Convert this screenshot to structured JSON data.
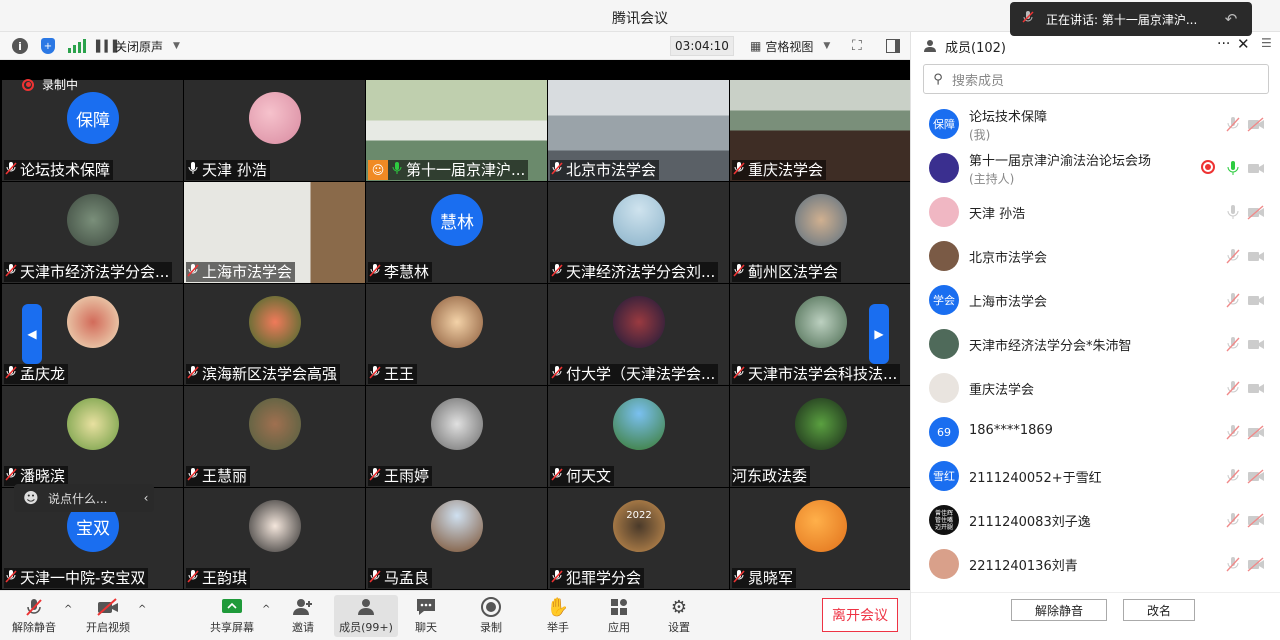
{
  "window": {
    "title": "腾讯会议"
  },
  "speaking_banner": {
    "label": "正在讲话: 第十一届京津沪..."
  },
  "toolbar": {
    "info_icon": "info-icon",
    "security_icon": "shield-icon",
    "signal_icon": "signal-bars-icon",
    "original_sound_label": "关闭原声",
    "timer": "03:04:10",
    "layout_label": "宫格视图"
  },
  "recording": {
    "label": "录制中"
  },
  "tiles": [
    {
      "name": "论坛技术保障",
      "avatar_text": "保障",
      "mic": "off"
    },
    {
      "name": "天津 孙浩",
      "mic": "on"
    },
    {
      "name": "第十一届京津沪...",
      "mic": "on",
      "host": true
    },
    {
      "name": "北京市法学会",
      "mic": "off"
    },
    {
      "name": "重庆法学会",
      "mic": "off"
    },
    {
      "name": "天津市经济法学分会...",
      "mic": "off"
    },
    {
      "name": "上海市法学会",
      "mic": "off"
    },
    {
      "name": "李慧林",
      "avatar_text": "慧林",
      "mic": "off"
    },
    {
      "name": "天津经济法学分会刘...",
      "mic": "off"
    },
    {
      "name": "蓟州区法学会",
      "mic": "off"
    },
    {
      "name": "孟庆龙",
      "mic": "off"
    },
    {
      "name": "滨海新区法学会高强",
      "mic": "off"
    },
    {
      "name": "王王",
      "mic": "off"
    },
    {
      "name": "付大学（天津法学会...",
      "mic": "off"
    },
    {
      "name": "天津市法学会科技法...",
      "mic": "off"
    },
    {
      "name": "潘晓滨",
      "mic": "off"
    },
    {
      "name": "王慧丽",
      "mic": "off"
    },
    {
      "name": "王雨婷",
      "mic": "off"
    },
    {
      "name": "何天文",
      "mic": "off"
    },
    {
      "name": "河东政法委",
      "mic": "none"
    },
    {
      "name": "天津一中院-安宝双",
      "avatar_text": "宝双",
      "mic": "off"
    },
    {
      "name": "王韵琪",
      "mic": "off"
    },
    {
      "name": "马孟良",
      "mic": "off"
    },
    {
      "name": "犯罪学分会",
      "mic": "off",
      "avatar_text": "2022"
    },
    {
      "name": "晁晓军",
      "mic": "off"
    }
  ],
  "chat_input": {
    "placeholder": "说点什么..."
  },
  "bottom_bar": {
    "unmute": "解除静音",
    "start_video": "开启视频",
    "share_screen": "共享屏幕",
    "invite": "邀请",
    "members": "成员(99+)",
    "chat": "聊天",
    "record": "录制",
    "raise_hand": "举手",
    "apps": "应用",
    "settings": "设置",
    "leave": "离开会议"
  },
  "panel": {
    "title": "成员(102)",
    "search_placeholder": "搜索成员",
    "members": [
      {
        "name": "论坛技术保障",
        "sub": "(我)",
        "avatar_text": "保障",
        "avatar_color": "#1a6ef0",
        "mic": "off",
        "cam": "off"
      },
      {
        "name": "第十一届京津沪渝法治论坛会场",
        "sub": "(主持人)",
        "avatar_color": "#3a2f8f",
        "mic": "on",
        "cam": "on",
        "recording": true
      },
      {
        "name": "天津 孙浩",
        "avatar_color": "#f0b7c3",
        "mic": "idle",
        "cam": "off"
      },
      {
        "name": "北京市法学会",
        "avatar_color": "#7a5a45",
        "mic": "off",
        "cam": "on"
      },
      {
        "name": "上海市法学会",
        "avatar_text": "学会",
        "avatar_color": "#1a6ef0",
        "mic": "off",
        "cam": "on"
      },
      {
        "name": "天津市经济法学分会*朱沛智",
        "avatar_color": "#4f6a5a",
        "mic": "off",
        "cam": "on"
      },
      {
        "name": "重庆法学会",
        "avatar_color": "#e9e4df",
        "mic": "off",
        "cam": "on"
      },
      {
        "name": "186****1869",
        "avatar_text": "69",
        "avatar_color": "#1a6ef0",
        "mic": "off",
        "cam": "off"
      },
      {
        "name": "2111240052+于雪红",
        "avatar_text": "雪红",
        "avatar_color": "#1a6ef0",
        "mic": "off",
        "cam": "off"
      },
      {
        "name": "2111240083刘子逸",
        "avatar_text": "曾佳辉\n管住嘴\n迈开腿",
        "avatar_color": "#111111",
        "mic": "off",
        "cam": "off"
      },
      {
        "name": "2211240136刘青",
        "avatar_color": "#d9a08a",
        "mic": "off",
        "cam": "off"
      }
    ],
    "unmute_all": "解除静音",
    "rename": "改名"
  }
}
